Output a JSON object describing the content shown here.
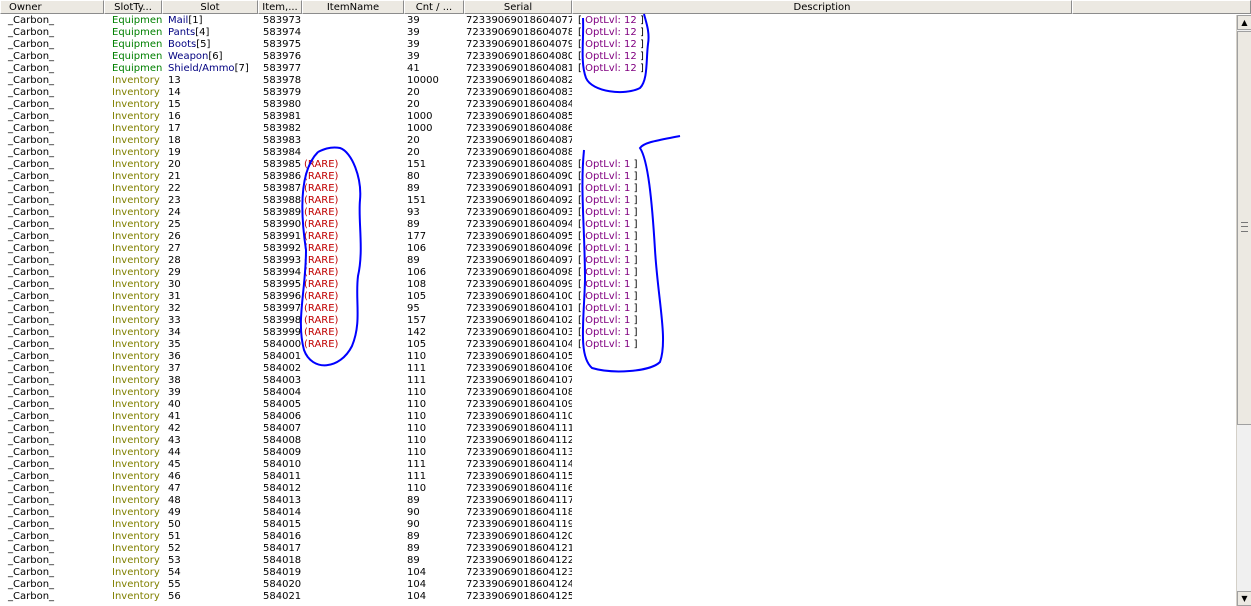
{
  "columns": {
    "owner": "Owner",
    "slottype": "SlotTy...",
    "slot": "Slot",
    "item": "Item,...",
    "itemname": "ItemName",
    "cnt": "Cnt / ...",
    "serial": "Serial",
    "description": "Description"
  },
  "rows": [
    {
      "owner": "_Carbon_",
      "type": "Equipmen",
      "slot": "Mail",
      "slot_idx": "[1]",
      "item": "583973",
      "name": "",
      "cnt": "39",
      "serial": "7233906901860407<u>7</u>",
      "desc": "OptLvl: 12"
    },
    {
      "owner": "_Carbon_",
      "type": "Equipmen",
      "slot": "Pants",
      "slot_idx": "[4]",
      "item": "583974",
      "name": "",
      "cnt": "39",
      "serial": "72339069018604078",
      "desc": "OptLvl: 12"
    },
    {
      "owner": "_Carbon_",
      "type": "Equipmen",
      "slot": "Boots",
      "slot_idx": "[5]",
      "item": "583975",
      "name": "",
      "cnt": "39",
      "serial": "72339069018604079",
      "desc": "OptLvl: 12"
    },
    {
      "owner": "_Carbon_",
      "type": "Equipmen",
      "slot": "Weapon",
      "slot_idx": "[6]",
      "item": "583976",
      "name": "",
      "cnt": "39",
      "serial": "72339069018604080",
      "desc": "OptLvl: 12"
    },
    {
      "owner": "_Carbon_",
      "type": "Equipmen",
      "slot": "Shield/Ammo",
      "slot_idx": "[7]",
      "item": "583977",
      "name": "",
      "cnt": "41",
      "serial": "72339069018604081",
      "desc": "OptLvl: 12"
    },
    {
      "owner": "_Carbon_",
      "type": "Inventory",
      "slot": "13",
      "slot_idx": "",
      "item": "583978",
      "name": "",
      "cnt": "10000",
      "serial": "72339069018604082",
      "desc": ""
    },
    {
      "owner": "_Carbon_",
      "type": "Inventory",
      "slot": "14",
      "slot_idx": "",
      "item": "583979",
      "name": "",
      "cnt": "20",
      "serial": "72339069018604083",
      "desc": ""
    },
    {
      "owner": "_Carbon_",
      "type": "Inventory",
      "slot": "15",
      "slot_idx": "",
      "item": "583980",
      "name": "",
      "cnt": "20",
      "serial": "72339069018604084",
      "desc": ""
    },
    {
      "owner": "_Carbon_",
      "type": "Inventory",
      "slot": "16",
      "slot_idx": "",
      "item": "583981",
      "name": "",
      "cnt": "1000",
      "serial": "72339069018604085",
      "desc": ""
    },
    {
      "owner": "_Carbon_",
      "type": "Inventory",
      "slot": "17",
      "slot_idx": "",
      "item": "583982",
      "name": "",
      "cnt": "1000",
      "serial": "72339069018604086",
      "desc": ""
    },
    {
      "owner": "_Carbon_",
      "type": "Inventory",
      "slot": "18",
      "slot_idx": "",
      "item": "583983",
      "name": "",
      "cnt": "20",
      "serial": "72339069018604087",
      "desc": ""
    },
    {
      "owner": "_Carbon_",
      "type": "Inventory",
      "slot": "19",
      "slot_idx": "",
      "item": "583984",
      "name": "",
      "cnt": "20",
      "serial": "72339069018604088",
      "desc": ""
    },
    {
      "owner": "_Carbon_",
      "type": "Inventory",
      "slot": "20",
      "slot_idx": "",
      "item": "583985",
      "name": "(RARE)",
      "cnt": "151",
      "serial": "72339069018604089",
      "desc": "OptLvl: 1"
    },
    {
      "owner": "_Carbon_",
      "type": "Inventory",
      "slot": "21",
      "slot_idx": "",
      "item": "583986",
      "name": "(RARE)",
      "cnt": "80",
      "serial": "72339069018604090",
      "desc": "OptLvl: 1"
    },
    {
      "owner": "_Carbon_",
      "type": "Inventory",
      "slot": "22",
      "slot_idx": "",
      "item": "583987",
      "name": "(RARE)",
      "cnt": "89",
      "serial": "72339069018604091",
      "desc": "OptLvl: 1"
    },
    {
      "owner": "_Carbon_",
      "type": "Inventory",
      "slot": "23",
      "slot_idx": "",
      "item": "583988",
      "name": "(RARE)",
      "cnt": "151",
      "serial": "72339069018604092",
      "desc": "OptLvl: 1"
    },
    {
      "owner": "_Carbon_",
      "type": "Inventory",
      "slot": "24",
      "slot_idx": "",
      "item": "583989",
      "name": "(RARE)",
      "cnt": "93",
      "serial": "72339069018604093",
      "desc": "OptLvl: 1"
    },
    {
      "owner": "_Carbon_",
      "type": "Inventory",
      "slot": "25",
      "slot_idx": "",
      "item": "583990",
      "name": "(RARE)",
      "cnt": "89",
      "serial": "72339069018604094",
      "desc": "OptLvl: 1"
    },
    {
      "owner": "_Carbon_",
      "type": "Inventory",
      "slot": "26",
      "slot_idx": "",
      "item": "583991",
      "name": "(RARE)",
      "cnt": "177",
      "serial": "72339069018604095",
      "desc": "OptLvl: 1"
    },
    {
      "owner": "_Carbon_",
      "type": "Inventory",
      "slot": "27",
      "slot_idx": "",
      "item": "583992",
      "name": "(RARE)",
      "cnt": "106",
      "serial": "72339069018604096",
      "desc": "OptLvl: 1"
    },
    {
      "owner": "_Carbon_",
      "type": "Inventory",
      "slot": "28",
      "slot_idx": "",
      "item": "583993",
      "name": "(RARE)",
      "cnt": "89",
      "serial": "72339069018604097",
      "desc": "OptLvl: 1"
    },
    {
      "owner": "_Carbon_",
      "type": "Inventory",
      "slot": "29",
      "slot_idx": "",
      "item": "583994",
      "name": "(RARE)",
      "cnt": "106",
      "serial": "72339069018604098",
      "desc": "OptLvl: 1"
    },
    {
      "owner": "_Carbon_",
      "type": "Inventory",
      "slot": "30",
      "slot_idx": "",
      "item": "583995",
      "name": "(RARE)",
      "cnt": "108",
      "serial": "72339069018604099",
      "desc": "OptLvl: 1"
    },
    {
      "owner": "_Carbon_",
      "type": "Inventory",
      "slot": "31",
      "slot_idx": "",
      "item": "583996",
      "name": "(RARE)",
      "cnt": "105",
      "serial": "72339069018604100",
      "desc": "OptLvl: 1"
    },
    {
      "owner": "_Carbon_",
      "type": "Inventory",
      "slot": "32",
      "slot_idx": "",
      "item": "583997",
      "name": "(RARE)",
      "cnt": "95",
      "serial": "72339069018604101",
      "desc": "OptLvl: 1"
    },
    {
      "owner": "_Carbon_",
      "type": "Inventory",
      "slot": "33",
      "slot_idx": "",
      "item": "583998",
      "name": "(RARE)",
      "cnt": "157",
      "serial": "72339069018604102",
      "desc": "OptLvl: 1"
    },
    {
      "owner": "_Carbon_",
      "type": "Inventory",
      "slot": "34",
      "slot_idx": "",
      "item": "583999",
      "name": "(RARE)",
      "cnt": "142",
      "serial": "72339069018604103",
      "desc": "OptLvl: 1"
    },
    {
      "owner": "_Carbon_",
      "type": "Inventory",
      "slot": "35",
      "slot_idx": "",
      "item": "584000",
      "name": "(RARE)",
      "cnt": "105",
      "serial": "72339069018604104",
      "desc": "OptLvl: 1"
    },
    {
      "owner": "_Carbon_",
      "type": "Inventory",
      "slot": "36",
      "slot_idx": "",
      "item": "584001",
      "name": "",
      "cnt": "110",
      "serial": "72339069018604105",
      "desc": ""
    },
    {
      "owner": "_Carbon_",
      "type": "Inventory",
      "slot": "37",
      "slot_idx": "",
      "item": "584002",
      "name": "",
      "cnt": "111",
      "serial": "72339069018604106",
      "desc": ""
    },
    {
      "owner": "_Carbon_",
      "type": "Inventory",
      "slot": "38",
      "slot_idx": "",
      "item": "584003",
      "name": "",
      "cnt": "111",
      "serial": "72339069018604107",
      "desc": ""
    },
    {
      "owner": "_Carbon_",
      "type": "Inventory",
      "slot": "39",
      "slot_idx": "",
      "item": "584004",
      "name": "",
      "cnt": "110",
      "serial": "72339069018604108",
      "desc": ""
    },
    {
      "owner": "_Carbon_",
      "type": "Inventory",
      "slot": "40",
      "slot_idx": "",
      "item": "584005",
      "name": "",
      "cnt": "110",
      "serial": "72339069018604109",
      "desc": ""
    },
    {
      "owner": "_Carbon_",
      "type": "Inventory",
      "slot": "41",
      "slot_idx": "",
      "item": "584006",
      "name": "",
      "cnt": "110",
      "serial": "72339069018604110",
      "desc": ""
    },
    {
      "owner": "_Carbon_",
      "type": "Inventory",
      "slot": "42",
      "slot_idx": "",
      "item": "584007",
      "name": "",
      "cnt": "110",
      "serial": "72339069018604111",
      "desc": ""
    },
    {
      "owner": "_Carbon_",
      "type": "Inventory",
      "slot": "43",
      "slot_idx": "",
      "item": "584008",
      "name": "",
      "cnt": "110",
      "serial": "72339069018604112",
      "desc": ""
    },
    {
      "owner": "_Carbon_",
      "type": "Inventory",
      "slot": "44",
      "slot_idx": "",
      "item": "584009",
      "name": "",
      "cnt": "110",
      "serial": "72339069018604113",
      "desc": ""
    },
    {
      "owner": "_Carbon_",
      "type": "Inventory",
      "slot": "45",
      "slot_idx": "",
      "item": "584010",
      "name": "",
      "cnt": "111",
      "serial": "72339069018604114",
      "desc": ""
    },
    {
      "owner": "_Carbon_",
      "type": "Inventory",
      "slot": "46",
      "slot_idx": "",
      "item": "584011",
      "name": "",
      "cnt": "111",
      "serial": "72339069018604115",
      "desc": ""
    },
    {
      "owner": "_Carbon_",
      "type": "Inventory",
      "slot": "47",
      "slot_idx": "",
      "item": "584012",
      "name": "",
      "cnt": "110",
      "serial": "72339069018604116",
      "desc": ""
    },
    {
      "owner": "_Carbon_",
      "type": "Inventory",
      "slot": "48",
      "slot_idx": "",
      "item": "584013",
      "name": "",
      "cnt": "89",
      "serial": "72339069018604117",
      "desc": ""
    },
    {
      "owner": "_Carbon_",
      "type": "Inventory",
      "slot": "49",
      "slot_idx": "",
      "item": "584014",
      "name": "",
      "cnt": "90",
      "serial": "72339069018604118",
      "desc": ""
    },
    {
      "owner": "_Carbon_",
      "type": "Inventory",
      "slot": "50",
      "slot_idx": "",
      "item": "584015",
      "name": "",
      "cnt": "90",
      "serial": "72339069018604119",
      "desc": ""
    },
    {
      "owner": "_Carbon_",
      "type": "Inventory",
      "slot": "51",
      "slot_idx": "",
      "item": "584016",
      "name": "",
      "cnt": "89",
      "serial": "72339069018604120",
      "desc": ""
    },
    {
      "owner": "_Carbon_",
      "type": "Inventory",
      "slot": "52",
      "slot_idx": "",
      "item": "584017",
      "name": "",
      "cnt": "89",
      "serial": "72339069018604121",
      "desc": ""
    },
    {
      "owner": "_Carbon_",
      "type": "Inventory",
      "slot": "53",
      "slot_idx": "",
      "item": "584018",
      "name": "",
      "cnt": "89",
      "serial": "72339069018604122",
      "desc": ""
    },
    {
      "owner": "_Carbon_",
      "type": "Inventory",
      "slot": "54",
      "slot_idx": "",
      "item": "584019",
      "name": "",
      "cnt": "104",
      "serial": "72339069018604123",
      "desc": ""
    },
    {
      "owner": "_Carbon_",
      "type": "Inventory",
      "slot": "55",
      "slot_idx": "",
      "item": "584020",
      "name": "",
      "cnt": "104",
      "serial": "72339069018604124",
      "desc": ""
    },
    {
      "owner": "_Carbon_",
      "type": "Inventory",
      "slot": "56",
      "slot_idx": "",
      "item": "584021",
      "name": "",
      "cnt": "104",
      "serial": "72339069018604125",
      "desc": ""
    }
  ],
  "desc_open": "[",
  "desc_close": "]",
  "colors": {
    "equip_type": "#008000",
    "inv_type": "#808000",
    "equip_slot": "#000080",
    "rare": "#c00000",
    "optlvl": "#800080",
    "ink": "#0000ff"
  },
  "icons": {
    "scroll_up": "triangle-up-icon",
    "scroll_down": "triangle-down-icon"
  }
}
